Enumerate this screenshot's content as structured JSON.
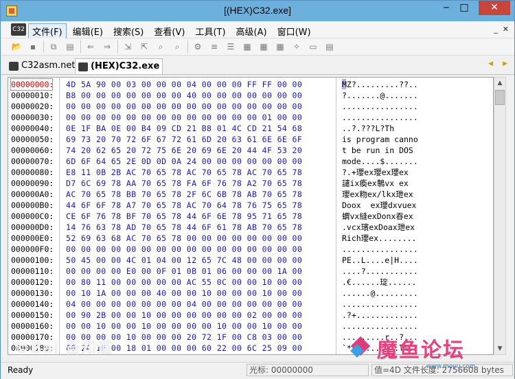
{
  "window": {
    "title": "[(HEX)C32.exe]"
  },
  "title_buttons": {
    "minimize": "‒",
    "maximize": "□",
    "close": "✕"
  },
  "menu": {
    "logo": "C32",
    "items": [
      "文件(F)",
      "编辑(E)",
      "搜索(S)",
      "查看(V)",
      "工具(T)",
      "高级(A)",
      "窗口(W)"
    ],
    "right": [
      "_",
      "✕"
    ]
  },
  "tabs": [
    {
      "label": "C32asm.net"
    },
    {
      "label": "(HEX)C32.exe"
    }
  ],
  "hex": {
    "lines": [
      {
        "addr": "00000000:",
        "bytes": "4D 5A 90 00 03 00 00 00 04 00 00 00 FF FF 00 00",
        "ascii": "MZ?.........??.."
      },
      {
        "addr": "00000010:",
        "bytes": "B8 00 00 00 00 00 00 00 40 00 00 00 00 00 00 00",
        "ascii": "?.......@......."
      },
      {
        "addr": "00000020:",
        "bytes": "00 00 00 00 00 00 00 00 00 00 00 00 00 00 00 00",
        "ascii": "................"
      },
      {
        "addr": "00000030:",
        "bytes": "00 00 00 00 00 00 00 00 00 00 00 00 00 01 00 00",
        "ascii": "................"
      },
      {
        "addr": "00000040:",
        "bytes": "0E 1F BA 0E 00 B4 09 CD 21 B8 01 4C CD 21 54 68",
        "ascii": "..?.???L?Th"
      },
      {
        "addr": "00000050:",
        "bytes": "69 73 20 70 72 6F 67 72 61 6D 20 63 61 6E 6E 6F",
        "ascii": "is program canno"
      },
      {
        "addr": "00000060:",
        "bytes": "74 20 62 65 20 72 75 6E 20 69 6E 20 44 4F 53 20",
        "ascii": "t be run in DOS "
      },
      {
        "addr": "00000070:",
        "bytes": "6D 6F 64 65 2E 0D 0D 0A 24 00 00 00 00 00 00 00",
        "ascii": "mode....$......."
      },
      {
        "addr": "00000080:",
        "bytes": "E8 11 0B 2B AC 70 65 78 AC 70 65 78 AC 70 65 78",
        "ascii": "?.+瓔ex瓔ex瓔ex"
      },
      {
        "addr": "00000090:",
        "bytes": "D7 6C 69 78 AA 70 65 78 FA 6F 76 78 A2 70 65 78",
        "ascii": "譴ix瘓ex鷒vx ex"
      },
      {
        "addr": "000000A0:",
        "bytes": "AC 70 65 78 BB 70 65 78 2F 6C 6B 78 AB 70 65 78",
        "ascii": "瓔ex粅ex/lkx玴ex"
      },
      {
        "addr": "000000B0:",
        "bytes": "44 6F 6F 78 A7 70 65 78 AC 70 64 78 76 75 65 78",
        "ascii": "Doox  ex瓔dxvuex"
      },
      {
        "addr": "000000C0:",
        "bytes": "CE 6F 76 78 BF 70 65 78 44 6F 6E 78 95 71 65 78",
        "ascii": "蝟vx縫exDonx昋ex"
      },
      {
        "addr": "000000D0:",
        "bytes": "14 76 63 78 AD 70 65 78 44 6F 61 78 AB 70 65 78",
        "ascii": ".vcx璸exDoax玴ex"
      },
      {
        "addr": "000000E0:",
        "bytes": "52 69 63 68 AC 70 65 78 00 00 00 00 00 00 00 00",
        "ascii": "Rich瓔ex........"
      },
      {
        "addr": "000000F0:",
        "bytes": "00 00 00 00 00 00 00 00 00 00 00 00 00 00 00 00",
        "ascii": "................"
      },
      {
        "addr": "00000100:",
        "bytes": "50 45 00 00 4C 01 04 00 12 65 7C 48 00 00 00 00",
        "ascii": "PE..L....e|H...."
      },
      {
        "addr": "00000110:",
        "bytes": "00 00 00 00 E0 00 0F 01 0B 01 06 00 00 00 1A 00",
        "ascii": "....?..........."
      },
      {
        "addr": "00000120:",
        "bytes": "00 80 11 00 00 00 00 00 AC 55 0C 00 00 10 00 00",
        "ascii": ".€......琔......"
      },
      {
        "addr": "00000130:",
        "bytes": "00 10 1A 00 00 00 40 00 00 10 00 00 00 10 00 00",
        "ascii": "......@........."
      },
      {
        "addr": "00000140:",
        "bytes": "04 00 00 00 00 00 00 00 04 00 00 00 00 00 00 00",
        "ascii": "................"
      },
      {
        "addr": "00000150:",
        "bytes": "00 90 2B 00 00 10 00 00 00 00 00 00 02 00 00 00",
        "ascii": ".?+............."
      },
      {
        "addr": "00000160:",
        "bytes": "00 00 10 00 00 10 00 00 00 00 10 00 00 10 00 00",
        "ascii": "................"
      },
      {
        "addr": "00000170:",
        "bytes": "00 00 00 00 10 00 00 00 20 72 1F 00 C8 03 00 00",
        "ascii": ".........r..?..."
      },
      {
        "addr": "00000180:",
        "bytes": "60 2A 1F 00 18 01 00 00 00 60 22 00 6C 25 09 00",
        "ascii": "`*.......`\".l%.."
      }
    ]
  },
  "status": {
    "ready": "Ready",
    "cursor_label": "光标: 00000000",
    "value_label": "值=4D 文件长度: 2756608 bytes"
  },
  "watermarks": {
    "left": "©Bai 吾知道",
    "right_text": "魔鱼论坛",
    "right_sub": "www.moyu.com"
  }
}
